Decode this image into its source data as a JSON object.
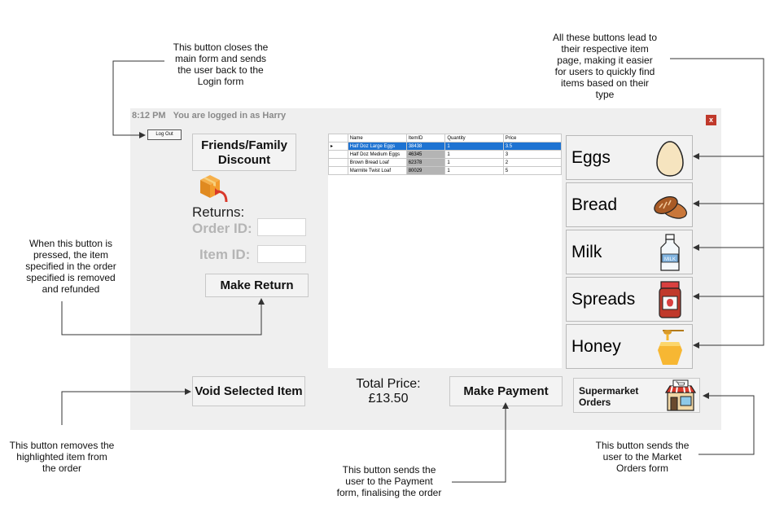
{
  "annotations": {
    "logout": [
      "This button closes the",
      "main form and sends",
      "the user back to the",
      "Login form"
    ],
    "categories": [
      "All these buttons lead to",
      "their respective item",
      "page, making it easier",
      "for users to quickly find",
      "items based on their",
      "type"
    ],
    "return": [
      "When this button is",
      "pressed, the item",
      "specified in the order",
      "specified is removed",
      "and refunded"
    ],
    "void": [
      "This button removes the",
      "highlighted item from",
      "the order"
    ],
    "payment": [
      "This button sends the",
      "user to the Payment",
      "form, finalising the order"
    ],
    "market": [
      "This button sends the",
      "user to the Market",
      "Orders form"
    ]
  },
  "status": {
    "time": "8:12 PM",
    "logged_in": "You are logged in as Harry"
  },
  "buttons": {
    "logout": "Log Out",
    "close": "x",
    "discount_line1": "Friends/Family",
    "discount_line2": "Discount",
    "make_return": "Make Return",
    "void": "Void Selected Item",
    "make_payment": "Make Payment",
    "supermarket_line1": "Supermarket",
    "supermarket_line2": "Orders"
  },
  "returns": {
    "heading": "Returns:",
    "order_label": "Order ID:",
    "item_label": "Item ID:",
    "order_value": "",
    "item_value": ""
  },
  "total": {
    "label": "Total Price:",
    "value": "£13.50"
  },
  "grid": {
    "columns": [
      "Name",
      "ItemID",
      "Quantity",
      "Price"
    ],
    "rows": [
      {
        "name": "Half Doz Large Eggs",
        "id": "38438",
        "qty": "1",
        "price": "3.5",
        "selected": true
      },
      {
        "name": "Half Doz Medium Eggs",
        "id": "46345",
        "qty": "1",
        "price": "3",
        "selected": false
      },
      {
        "name": "Brown Bread Loaf",
        "id": "62378",
        "qty": "1",
        "price": "2",
        "selected": false
      },
      {
        "name": "Marmite Twist Loaf",
        "id": "80029",
        "qty": "1",
        "price": "5",
        "selected": false
      }
    ]
  },
  "categories": [
    {
      "label": "Eggs",
      "icon": "egg-icon"
    },
    {
      "label": "Bread",
      "icon": "bread-icon"
    },
    {
      "label": "Milk",
      "icon": "milk-bottle-icon"
    },
    {
      "label": "Spreads",
      "icon": "jam-jar-icon"
    },
    {
      "label": "Honey",
      "icon": "honey-jar-icon"
    }
  ],
  "icons": {
    "returns": "return-box-icon",
    "store": "store-front-icon",
    "row_pointer": "row-pointer-icon"
  },
  "colors": {
    "form_bg": "#efefef",
    "close_btn": "#c0392b",
    "selection": "#1e73d2"
  }
}
